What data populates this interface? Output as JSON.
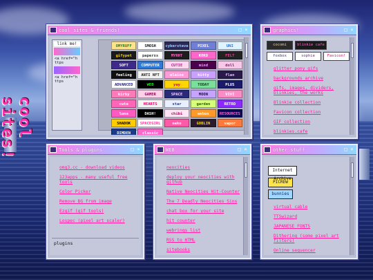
{
  "side_title": "cool sites!",
  "windows": {
    "cool_sites": {
      "title": "cool sites & friends!",
      "link_me": {
        "title": "link me!",
        "code_1": "<a href=\"https",
        "code_2": "<a href=\"https"
      },
      "badges": [
        {
          "label": "OMYRUFF",
          "bg": "#ffe38a",
          "fg": "#2a7a2a"
        },
        {
          "label": "SMOSH",
          "bg": "#ffffff",
          "fg": "#111111"
        },
        {
          "label": "cybersteve",
          "bg": "#2a2a5a",
          "fg": "#9fd0ff"
        },
        {
          "label": "PIXEL",
          "bg": "#6f7fd8",
          "fg": "#ffffff"
        },
        {
          "label": "UNI",
          "bg": "#e0f4ff",
          "fg": "#2b6fd0"
        },
        {
          "label": "gifypet",
          "bg": "#1a1a1a",
          "fg": "#ffcc00"
        },
        {
          "label": "paperxs",
          "bg": "#ffffff",
          "fg": "#333333"
        },
        {
          "label": "MYRHT",
          "bg": "#1d1d1d",
          "fg": "#ff66cc"
        },
        {
          "label": "KOKO",
          "bg": "#ff66cc",
          "fg": "#ffffff"
        },
        {
          "label": "FELT",
          "bg": "#222222",
          "fg": "#ff3399"
        },
        {
          "label": "SOFT",
          "bg": "#3d2a8a",
          "fg": "#ffffff"
        },
        {
          "label": "COMPUTER",
          "bg": "#2e7ad6",
          "fg": "#ffffff"
        },
        {
          "label": "CUTIE",
          "bg": "#ffd6f0",
          "fg": "#c4108a"
        },
        {
          "label": "mind",
          "bg": "#4a004a",
          "fg": "#ff99ff"
        },
        {
          "label": "doll",
          "bg": "#f8c8e8",
          "fg": "#7a2a6a"
        },
        {
          "label": "feeling",
          "bg": "#101010",
          "fg": "#ffffff"
        },
        {
          "label": "ANTI NFT",
          "bg": "#f2f2f2",
          "fg": "#222222"
        },
        {
          "label": "elaine",
          "bg": "#ff9ad8",
          "fg": "#ffffff"
        },
        {
          "label": "kitty",
          "bg": "#c9a0ff",
          "fg": "#ffffff"
        },
        {
          "label": "flan",
          "bg": "#2a1a4a",
          "fg": "#e0c0ff"
        },
        {
          "label": "ADVANCED",
          "bg": "#ffffff",
          "fg": "#1a1a8a"
        },
        {
          "label": "WEB",
          "bg": "#000000",
          "fg": "#00ff00"
        },
        {
          "label": "yay",
          "bg": "#ffd600",
          "fg": "#d0006a"
        },
        {
          "label": "TODAY",
          "bg": "#7adf9a",
          "fg": "#1a3a1a"
        },
        {
          "label": "PLUS",
          "bg": "#1a1a6a",
          "fg": "#ffffff"
        },
        {
          "label": "kirby",
          "bg": "#ff7ab8",
          "fg": "#ffffff"
        },
        {
          "label": "GAMER",
          "bg": "#ffd0e8",
          "fg": "#8a0a5a"
        },
        {
          "label": "SPACE",
          "bg": "#2a2a7a",
          "fg": "#ffd0ff"
        },
        {
          "label": "MOON",
          "bg": "#c4a4ff",
          "fg": "#2a0a4a"
        },
        {
          "label": "VIVI",
          "bg": "#ff8ac8",
          "fg": "#ffffff"
        },
        {
          "label": "cute",
          "bg": "#ff66b8",
          "fg": "#ffffff"
        },
        {
          "label": "HEARTS",
          "bg": "#f4f4f4",
          "fg": "#e0006a"
        },
        {
          "label": "star",
          "bg": "#e8f0ff",
          "fg": "#2040a0"
        },
        {
          "label": "garden",
          "bg": "#d8ff7a",
          "fg": "#2a5a0a"
        },
        {
          "label": "RETRO",
          "bg": "#8a2aff",
          "fg": "#ffffff"
        },
        {
          "label": "luna",
          "bg": "#ff5ac0",
          "fg": "#ffffff"
        },
        {
          "label": "DASH!",
          "bg": "#000000",
          "fg": "#ffffff"
        },
        {
          "label": "chibi",
          "bg": "#ffe4f4",
          "fg": "#c0006a"
        },
        {
          "label": "webos",
          "bg": "#ff9a2a",
          "fg": "#ffffff"
        },
        {
          "label": "RESOURCES",
          "bg": "#0a0a5a",
          "fg": "#ff66cc"
        },
        {
          "label": "SHADOK",
          "bg": "#ffcc00",
          "fg": "#000000"
        },
        {
          "label": "SPACEGIRL",
          "bg": "#ffffff",
          "fg": "#ff3399"
        },
        {
          "label": "neko",
          "bg": "#ff5aa8",
          "fg": "#ffffff"
        },
        {
          "label": "GOBLIN",
          "bg": "#2a1a2a",
          "fg": "#ffd600"
        },
        {
          "label": "vapor",
          "bg": "#ff7a3a",
          "fg": "#ffffff"
        },
        {
          "label": "DIMDEN",
          "bg": "#1a3a8a",
          "fg": "#ffffff"
        },
        {
          "label": "classic",
          "bg": "#ff66cc",
          "fg": "#ffffff"
        }
      ]
    },
    "graphics": {
      "title": "graphics!",
      "badges": [
        {
          "label": "cocomi",
          "bg": "#2a2a2a",
          "fg": "#ffcc66"
        },
        {
          "label": "blinkie cafe",
          "bg": "#1a1a1a",
          "fg": "#ff66cc"
        },
        {
          "label": "foxbox",
          "bg": "#ffffff",
          "fg": "#2a2a8a"
        },
        {
          "label": "sophie",
          "bg": "#ffffff",
          "fg": "#6a2a8a"
        },
        {
          "label": "Favicon!",
          "bg": "#ffffff",
          "fg": "#e0006a"
        }
      ],
      "links": [
        "glitter pony gifs",
        "backgrounds archive",
        "gifs, images, dividers, blinkies, the works",
        "Blinkie collection",
        "Favicon collection",
        "GIF collection",
        "blinkies.cafe"
      ]
    },
    "tools": {
      "title": "Tools & plugins",
      "links": [
        "omg3.cc - download videos",
        "123apps - many useful free tools",
        "Color Picker",
        "Remove BG from image",
        "Ezgif (gif tools)",
        "Lospec (pixel art scaler)"
      ],
      "footer": "plugins"
    },
    "web": {
      "title": "WEB",
      "links": [
        "neocities",
        "deploy your neocities with github",
        "Native Neocities Hit-Counter",
        "The 7 Deadly Neocities Sins",
        "chat box for your site",
        "hit counter",
        "webrings list",
        "RSS to HTML",
        "sitebooks"
      ]
    },
    "other": {
      "title": "other stuff",
      "stamps": [
        "Internet Archive",
        "PICREW",
        "bunnies"
      ],
      "links": [
        "virtual cable",
        "TTSwizard",
        "JAPANESE FONTS",
        "Dithering (some pixel art filters)",
        "Online sequencer"
      ]
    }
  }
}
